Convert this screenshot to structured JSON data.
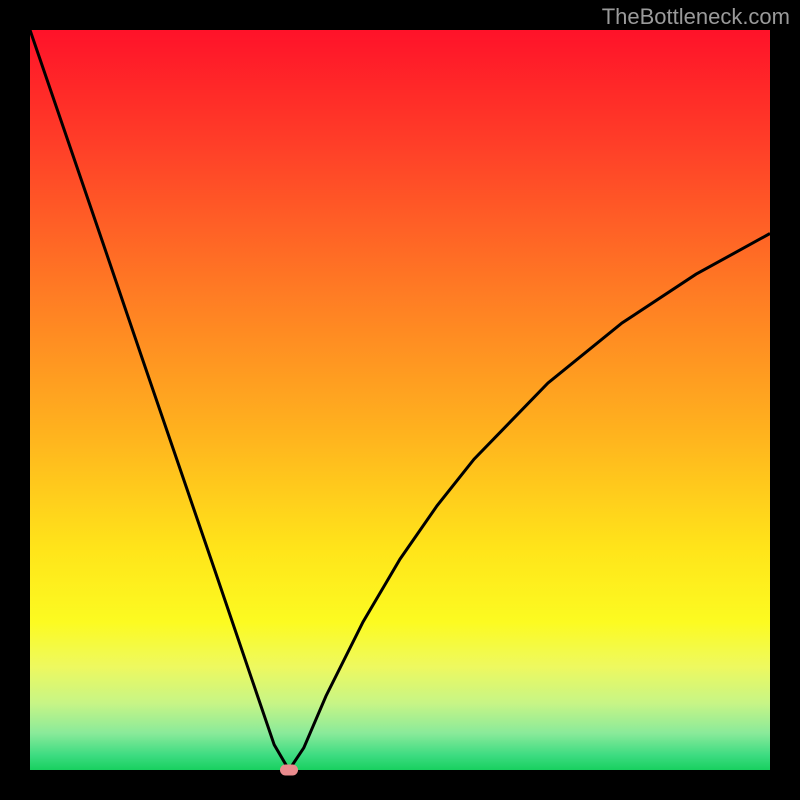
{
  "watermark": "TheBottleneck.com",
  "chart_data": {
    "type": "line",
    "title": "",
    "xlabel": "",
    "ylabel": "",
    "xlim": [
      0,
      100
    ],
    "ylim": [
      0,
      100
    ],
    "grid": false,
    "x": [
      0,
      5,
      10,
      15,
      20,
      25,
      30,
      33,
      35,
      37,
      40,
      45,
      50,
      55,
      60,
      70,
      80,
      90,
      100
    ],
    "values": [
      100,
      85.4,
      70.8,
      56.1,
      41.5,
      26.9,
      12.2,
      3.4,
      0.0,
      3.0,
      10.0,
      20.0,
      28.5,
      35.7,
      42.0,
      52.3,
      60.4,
      67.0,
      72.5
    ],
    "marker": {
      "x": 35,
      "y": 0
    },
    "background_gradient": {
      "top": "#ff1229",
      "bottom": "#18d05f"
    },
    "curve_color": "#000000",
    "marker_color": "#e98b8d"
  }
}
